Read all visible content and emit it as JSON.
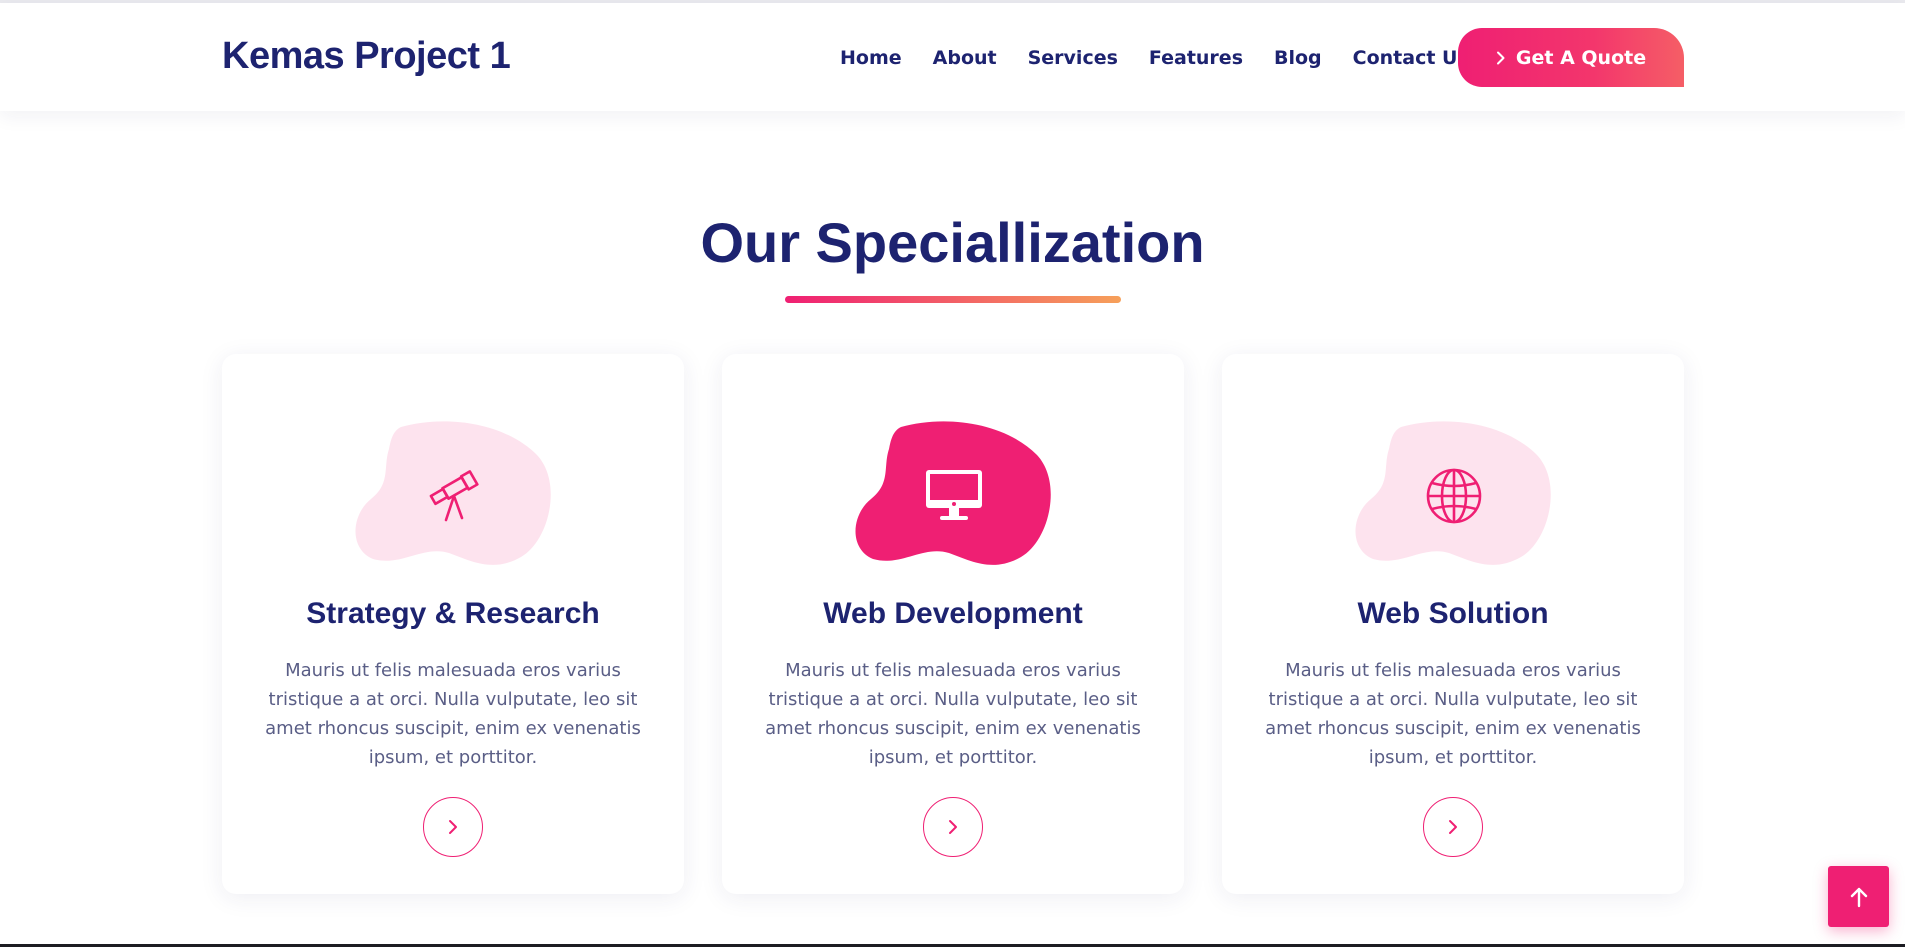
{
  "header": {
    "brand": "Kemas Project 1",
    "nav": [
      "Home",
      "About",
      "Services",
      "Features",
      "Blog",
      "Contact Us"
    ],
    "cta_label": "Get A Quote"
  },
  "section": {
    "title": "Our Speciallization"
  },
  "cards": [
    {
      "title": "Strategy & Research",
      "text": "Mauris ut felis malesuada eros varius tristique a at orci. Nulla vulputate, leo sit amet rhoncus suscipit, enim ex venenatis ipsum, et porttitor.",
      "icon": "telescope-icon",
      "active": false
    },
    {
      "title": "Web Development",
      "text": "Mauris ut felis malesuada eros varius tristique a at orci. Nulla vulputate, leo sit amet rhoncus suscipit, enim ex venenatis ipsum, et porttitor.",
      "icon": "desktop-icon",
      "active": true
    },
    {
      "title": "Web Solution",
      "text": "Mauris ut felis malesuada eros varius tristique a at orci. Nulla vulputate, leo sit amet rhoncus suscipit, enim ex venenatis ipsum, et porttitor.",
      "icon": "globe-icon",
      "active": false
    }
  ],
  "colors": {
    "primary": "#ef1f73",
    "navy": "#1d2370",
    "blob_light": "#fde3ee",
    "text_muted": "#5a5e86"
  }
}
